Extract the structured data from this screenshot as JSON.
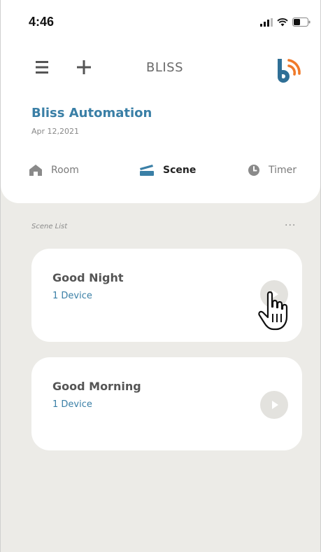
{
  "status_bar": {
    "time": "4:46",
    "icons": [
      "cellular-signal-icon",
      "wifi-icon",
      "battery-icon"
    ]
  },
  "nav": {
    "menu_icon": "hamburger-menu-icon",
    "add_icon": "plus-icon",
    "title": "BLISS",
    "logo_icon": "bliss-logo-icon"
  },
  "home": {
    "name": "Bliss Automation",
    "date": "Apr 12,2021"
  },
  "tabs": [
    {
      "label": "Room",
      "icon": "house-icon",
      "active": false
    },
    {
      "label": "Scene",
      "icon": "scene-clapper-icon",
      "active": true
    },
    {
      "label": "Timer",
      "icon": "clock-icon",
      "active": false
    }
  ],
  "scene_list": {
    "label": "Scene List",
    "more": "···",
    "items": [
      {
        "title": "Good Night",
        "subtitle": "1 Device",
        "play_icon": "play-icon"
      },
      {
        "title": "Good Morning",
        "subtitle": "1 Device",
        "play_icon": "play-icon"
      }
    ]
  },
  "colors": {
    "accent": "#3a7fa6",
    "logo_orange": "#f07a2a",
    "background": "#ecebe7",
    "card": "#ffffff"
  }
}
